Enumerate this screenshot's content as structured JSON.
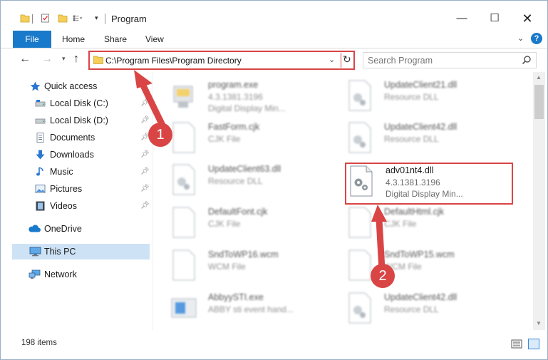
{
  "window": {
    "title": "Program",
    "controls": {
      "minimize": "—",
      "maximize": "☐",
      "close": "✕"
    }
  },
  "ribbon": {
    "file": "File",
    "home": "Home",
    "share": "Share",
    "view": "View"
  },
  "nav": {
    "address": "C:\\Program Files\\Program Directory",
    "search_placeholder": "Search Program"
  },
  "sidebar": {
    "quick_access": "Quick access",
    "items": [
      {
        "label": "Local Disk (C:)",
        "icon": "drive-icon",
        "pinned": true
      },
      {
        "label": "Local Disk (D:)",
        "icon": "drive-icon",
        "pinned": true
      },
      {
        "label": "Documents",
        "icon": "documents-icon",
        "pinned": true
      },
      {
        "label": "Downloads",
        "icon": "downloads-icon",
        "pinned": true
      },
      {
        "label": "Music",
        "icon": "music-icon",
        "pinned": true
      },
      {
        "label": "Pictures",
        "icon": "pictures-icon",
        "pinned": true
      },
      {
        "label": "Videos",
        "icon": "videos-icon",
        "pinned": true
      }
    ],
    "onedrive": "OneDrive",
    "this_pc": "This PC",
    "network": "Network"
  },
  "files": [
    {
      "name": "program.exe",
      "line2": "4.3.1381.3196",
      "line3": "Digital Display Min...",
      "icon": "exe-icon"
    },
    {
      "name": "UpdateClient21.dll",
      "line2": "Resource DLL",
      "line3": "",
      "icon": "dll-icon"
    },
    {
      "name": "FastForm.cjk",
      "line2": "CJK File",
      "line3": "",
      "icon": "file-icon"
    },
    {
      "name": "UpdateClient42.dll",
      "line2": "Resource DLL",
      "line3": "",
      "icon": "dll-icon"
    },
    {
      "name": "UpdateClient63.dll",
      "line2": "Resource DLL",
      "line3": "",
      "icon": "dll-icon"
    },
    {
      "name": "adv01nt4.dll",
      "line2": "4.3.1381.3196",
      "line3": "Digital Display Min...",
      "icon": "dll-icon"
    },
    {
      "name": "DefaultFont.cjk",
      "line2": "CJK File",
      "line3": "",
      "icon": "file-icon"
    },
    {
      "name": "DefaultHtml.cjk",
      "line2": "CJK File",
      "line3": "",
      "icon": "file-icon"
    },
    {
      "name": "SndToWP16.wcm",
      "line2": "WCM File",
      "line3": "",
      "icon": "file-icon"
    },
    {
      "name": "SndToWP15.wcm",
      "line2": "WCM File",
      "line3": "",
      "icon": "file-icon"
    },
    {
      "name": "AbbyySTI.exe",
      "line2": "ABBY sti event hand...",
      "line3": "",
      "icon": "exe-blue-icon"
    },
    {
      "name": "UpdateClient42.dll",
      "line2": "Resource DLL",
      "line3": "",
      "icon": "dll-icon"
    }
  ],
  "status": {
    "items": "198 items"
  },
  "annotations": {
    "step1": "1",
    "step2": "2",
    "color": "#d94545"
  },
  "colors": {
    "accent": "#1979ca",
    "selected": "#cde2f5",
    "annotation": "#d94545"
  }
}
